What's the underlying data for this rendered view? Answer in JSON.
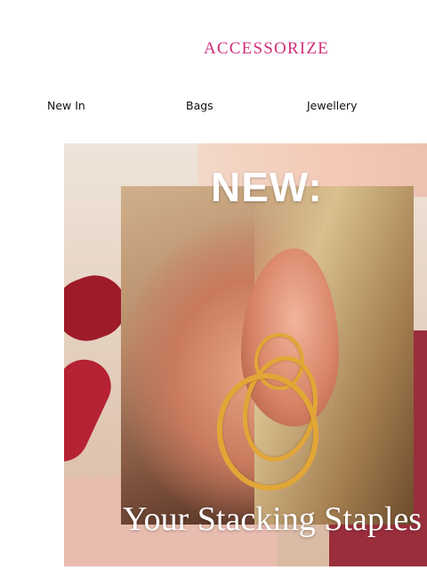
{
  "brand": {
    "name": "ACCESSORIZE",
    "color": "#d12e7a"
  },
  "nav": {
    "items": [
      {
        "label": "New In"
      },
      {
        "label": "Bags"
      },
      {
        "label": "Jewellery"
      }
    ]
  },
  "hero": {
    "headline": "NEW:",
    "tagline": "Your Stacking Staples",
    "image": "woman-ear-with-gold-hoop-earrings"
  }
}
